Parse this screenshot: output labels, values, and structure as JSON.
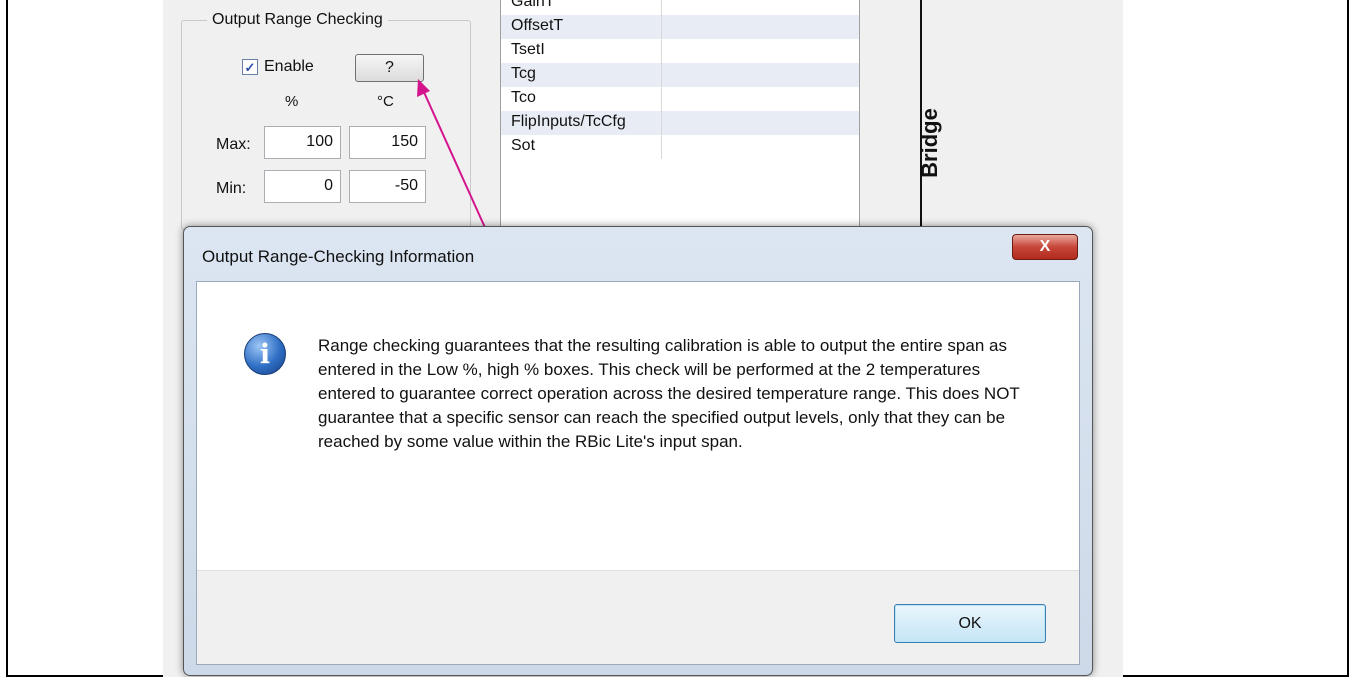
{
  "background": {
    "group_title": "Output Range Checking",
    "enable_label": "Enable",
    "help_button_label": "?",
    "unit_percent": "%",
    "unit_celsius": "°C",
    "max_label": "Max:",
    "min_label": "Min:",
    "max_percent": "100",
    "max_celsius": "150",
    "min_percent": "0",
    "min_celsius": "-50",
    "list_items": [
      "GainT",
      "OffsetT",
      "TsetI",
      "Tcg",
      "Tco",
      "FlipInputs/TcCfg",
      "Sot"
    ],
    "side_label": "Bridge"
  },
  "colors": {
    "arrow": "#d4148c",
    "accent": "#2f6ec4"
  },
  "dialog": {
    "title": "Output Range-Checking Information",
    "close_glyph": "X",
    "icon": "info-icon",
    "message": "Range checking guarantees that the resulting calibration is able to output the entire span as entered in the Low %, high % boxes. This check will be performed at the 2 temperatures entered to guarantee correct operation across the desired temperature range. This does NOT guarantee that a specific sensor can reach the specified output levels, only that they can be reached by some value within the RBic Lite's input span.",
    "ok_label": "OK"
  }
}
